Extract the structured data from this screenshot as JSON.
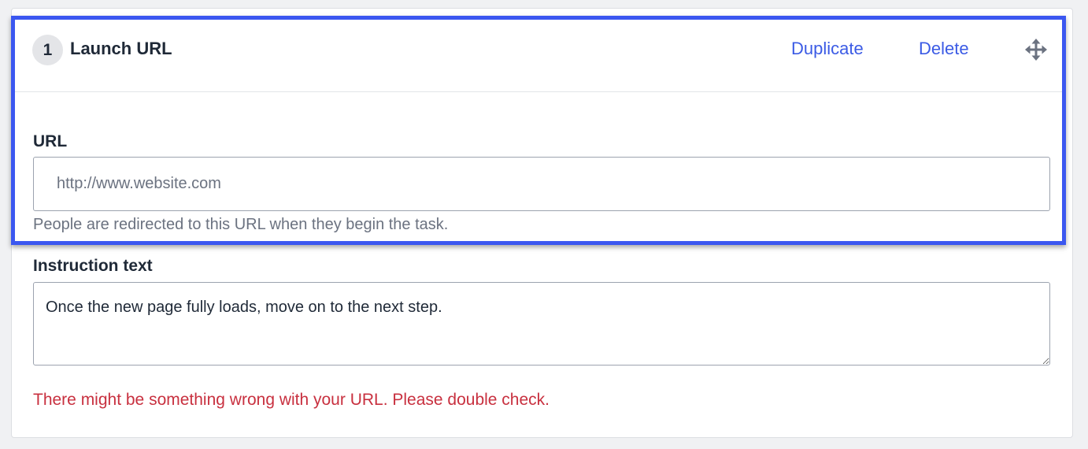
{
  "step": {
    "number": "1",
    "title": "Launch URL",
    "duplicate_label": "Duplicate",
    "delete_label": "Delete",
    "move_icon": "move-icon"
  },
  "url_field": {
    "label": "URL",
    "value": "",
    "placeholder": "http://www.website.com",
    "hint": "People are redirected to this URL when they begin the task."
  },
  "instruction_field": {
    "label": "Instruction text",
    "value": "Once the new page fully loads, move on to the next step."
  },
  "error_message": "There might be something wrong with your URL. Please double check.",
  "colors": {
    "accent": "#3b5be5",
    "highlight": "#3b57f0",
    "error": "#c8303f"
  }
}
